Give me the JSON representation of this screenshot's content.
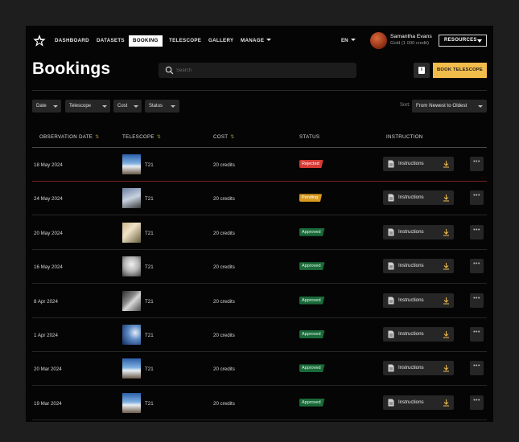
{
  "nav": {
    "items": [
      "DASHBOARD",
      "DATASETS",
      "BOOKING",
      "TELESCOPE",
      "GALLERY",
      "MANAGE"
    ],
    "active": "BOOKING",
    "lang": "EN",
    "user_name": "Samantha Evans",
    "user_credit": "Gold (1 000 credit)",
    "resources_label": "RESOURCES"
  },
  "header": {
    "title": "Bookings",
    "search_placeholder": "Search",
    "info_label": "i",
    "book_button": "BOOK TELESCOPE"
  },
  "filters": [
    "Date",
    "Telescope",
    "Cost",
    "Status"
  ],
  "sort": {
    "label": "Sort:",
    "value": "From Newest to Oldest"
  },
  "table": {
    "headers": [
      "OBSERVATION DATE",
      "TELESCOPE",
      "COST",
      "STATUS",
      "INSTRUCTION"
    ],
    "instruction_label": "Instructions",
    "more_label": "•••",
    "rows": [
      {
        "date": "18 May 2024",
        "telescope": "T21",
        "cost": "20 credits",
        "status": "Rejected"
      },
      {
        "date": "24 May 2024",
        "telescope": "T21",
        "cost": "20 credits",
        "status": "Pending"
      },
      {
        "date": "20 May 2024",
        "telescope": "T21",
        "cost": "20 credits",
        "status": "Approved"
      },
      {
        "date": "16 May 2024",
        "telescope": "T21",
        "cost": "20 credits",
        "status": "Approved"
      },
      {
        "date": "8 Apr 2024",
        "telescope": "T21",
        "cost": "20 credits",
        "status": "Approved"
      },
      {
        "date": "1 Apr 2024",
        "telescope": "T21",
        "cost": "20 credits",
        "status": "Approved"
      },
      {
        "date": "20 Mar 2024",
        "telescope": "T21",
        "cost": "20 credits",
        "status": "Approved"
      },
      {
        "date": "19 Mar 2024",
        "telescope": "T21",
        "cost": "20 credits",
        "status": "Approved"
      }
    ]
  },
  "colors": {
    "accent": "#f2bc4b",
    "rejected": "#d63a34",
    "pending": "#d99a1f",
    "approved": "#1b6a3a",
    "background": "#050505"
  }
}
